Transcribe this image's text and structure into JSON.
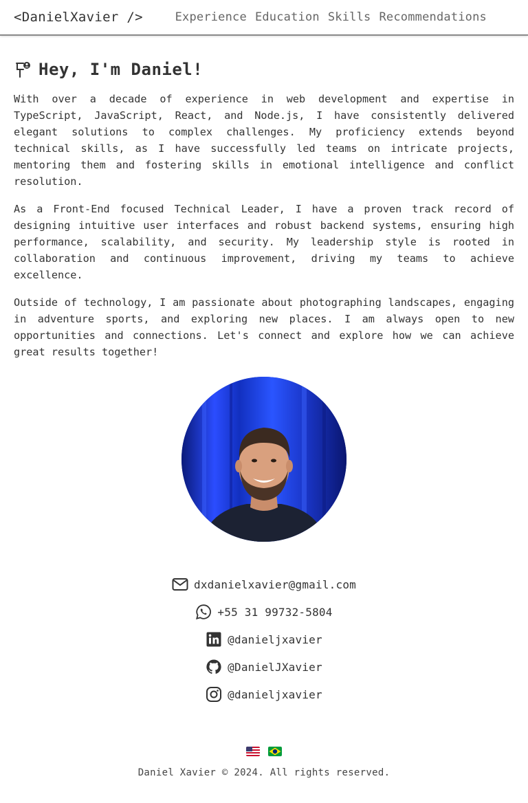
{
  "header": {
    "logo": "<DanielXavier />",
    "nav": [
      "Experience",
      "Education",
      "Skills",
      "Recommendations"
    ]
  },
  "intro": {
    "title": "Hey, I'm Daniel!",
    "title_icon": "person-pin-icon",
    "paragraphs": [
      "With over a decade of experience in web development and expertise in TypeScript, JavaScript, React, and Node.js, I have consistently delivered elegant solutions to complex challenges. My proficiency extends beyond technical skills, as I have successfully led teams on intricate projects, mentoring them and fostering skills in emotional intelligence and conflict resolution.",
      "As a Front-End focused Technical Leader, I have a proven track record of designing intuitive user interfaces and robust backend systems, ensuring high performance, scalability, and security. My leadership style is rooted in collaboration and continuous improvement, driving my teams to achieve excellence.",
      "Outside of technology, I am passionate about photographing landscapes, engaging in adventure sports, and exploring new places. I am always open to new opportunities and connections. Let's connect and explore how we can achieve great results together!"
    ]
  },
  "contacts": [
    {
      "icon": "envelope-icon",
      "text": "dxdanielxavier@gmail.com"
    },
    {
      "icon": "whatsapp-icon",
      "text": "+55 31 99732-5804"
    },
    {
      "icon": "linkedin-icon",
      "text": "@danieljxavier"
    },
    {
      "icon": "github-icon",
      "text": "@DanielJXavier"
    },
    {
      "icon": "instagram-icon",
      "text": "@danieljxavier"
    }
  ],
  "flags": [
    "us-flag-icon",
    "brazil-flag-icon"
  ],
  "footer": {
    "copyright": "Daniel Xavier © 2024. All rights reserved."
  },
  "colors": {
    "text": "#333333",
    "nav": "#666666",
    "divider": "#8a8a8a",
    "avatar_bg": "#1637c9"
  }
}
